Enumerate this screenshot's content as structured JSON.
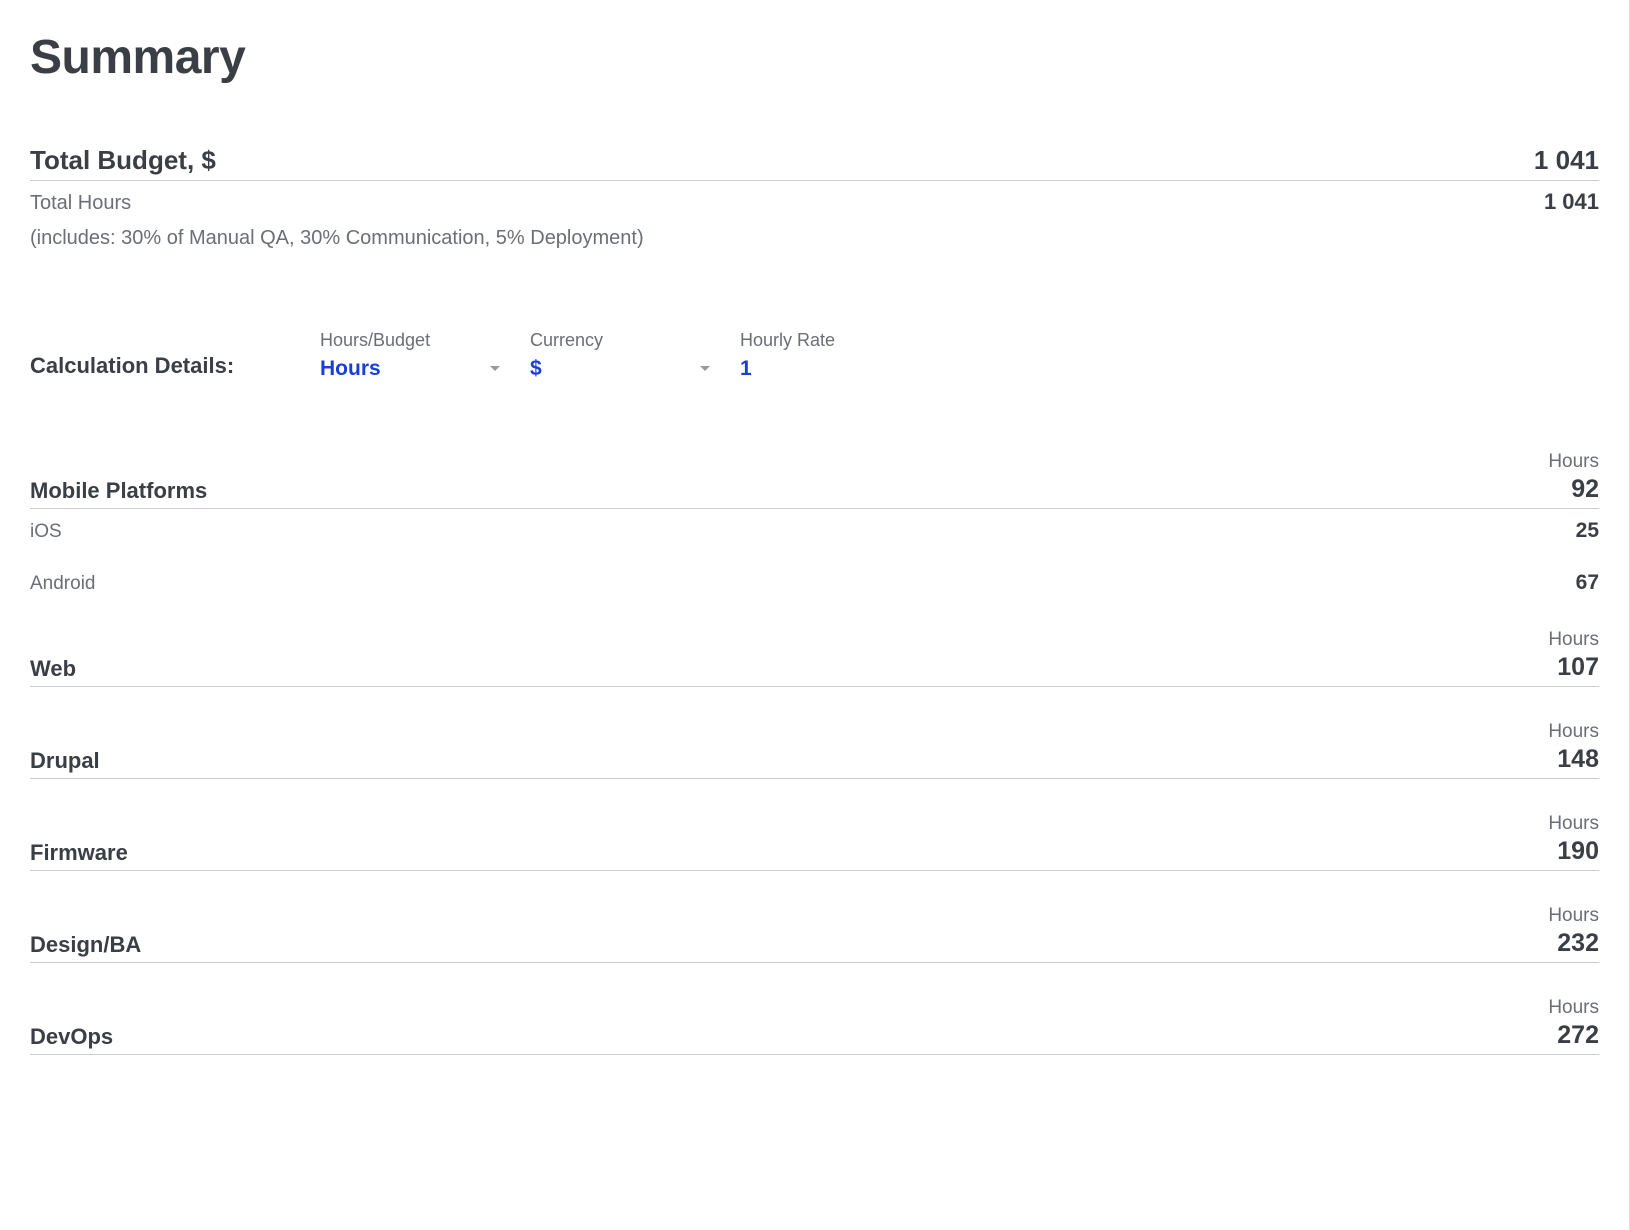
{
  "title": "Summary",
  "totalBudget": {
    "label": "Total Budget, $",
    "value": "1 041"
  },
  "totalHours": {
    "label": "Total Hours",
    "value": "1 041"
  },
  "includes": "(includes: 30% of Manual QA, 30% Communication, 5% Deployment)",
  "calc": {
    "heading": "Calculation Details:",
    "hoursBudget": {
      "label": "Hours/Budget",
      "value": "Hours"
    },
    "currency": {
      "label": "Currency",
      "value": "$"
    },
    "hourlyRate": {
      "label": "Hourly Rate",
      "value": "1"
    }
  },
  "unitLabel": "Hours",
  "sections": [
    {
      "name": "Mobile Platforms",
      "value": "92",
      "items": [
        {
          "name": "iOS",
          "value": "25"
        },
        {
          "name": "Android",
          "value": "67"
        }
      ]
    },
    {
      "name": "Web",
      "value": "107",
      "items": []
    },
    {
      "name": "Drupal",
      "value": "148",
      "items": []
    },
    {
      "name": "Firmware",
      "value": "190",
      "items": []
    },
    {
      "name": "Design/BA",
      "value": "232",
      "items": []
    },
    {
      "name": "DevOps",
      "value": "272",
      "items": []
    }
  ]
}
